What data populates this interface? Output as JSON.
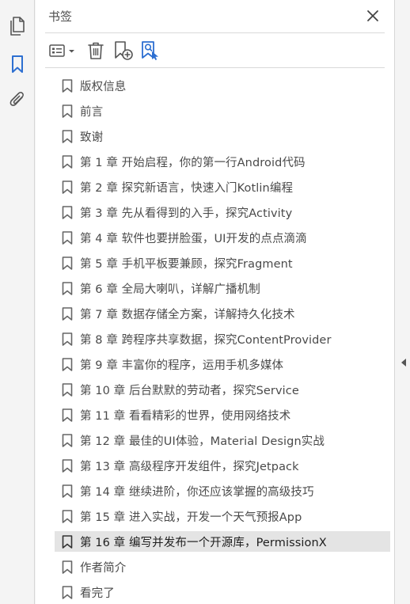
{
  "rail": {
    "items": [
      {
        "icon": "pages-icon"
      },
      {
        "icon": "bookmark-icon",
        "active": true
      },
      {
        "icon": "attachment-icon"
      }
    ]
  },
  "panel": {
    "title": "书签"
  },
  "toolbar": {
    "tools": [
      "options-menu-icon",
      "delete-icon",
      "new-bookmark-icon",
      "find-current-bookmark-icon"
    ]
  },
  "bookmarks": [
    {
      "label": "版权信息"
    },
    {
      "label": "前言"
    },
    {
      "label": "致谢"
    },
    {
      "label": "第 1 章 开始启程，你的第一行Android代码"
    },
    {
      "label": "第 2 章 探究新语言，快速入门Kotlin编程"
    },
    {
      "label": "第 3 章 先从看得到的入手，探究Activity"
    },
    {
      "label": "第 4 章 软件也要拼脸蛋，UI开发的点点滴滴"
    },
    {
      "label": "第 5 章 手机平板要兼顾，探究Fragment"
    },
    {
      "label": "第 6 章 全局大喇叭，详解广播机制"
    },
    {
      "label": "第 7 章 数据存储全方案，详解持久化技术"
    },
    {
      "label": "第 8 章 跨程序共享数据，探究ContentProvider"
    },
    {
      "label": "第 9 章 丰富你的程序，运用手机多媒体"
    },
    {
      "label": "第 10 章 后台默默的劳动者，探究Service"
    },
    {
      "label": "第 11 章 看看精彩的世界，使用网络技术"
    },
    {
      "label": "第 12 章 最佳的UI体验，Material Design实战"
    },
    {
      "label": "第 13 章 高级程序开发组件，探究Jetpack"
    },
    {
      "label": "第 14 章 继续进阶，你还应该掌握的高级技巧"
    },
    {
      "label": "第 15 章 进入实战，开发一个天气预报App"
    },
    {
      "label": "第 16 章 编写并发布一个开源库，PermissionX",
      "selected": true
    },
    {
      "label": "作者简介"
    },
    {
      "label": "看完了"
    }
  ],
  "colors": {
    "accent": "#2d6fd1",
    "icon": "#555555",
    "selected_bg": "#e4e4e4"
  }
}
